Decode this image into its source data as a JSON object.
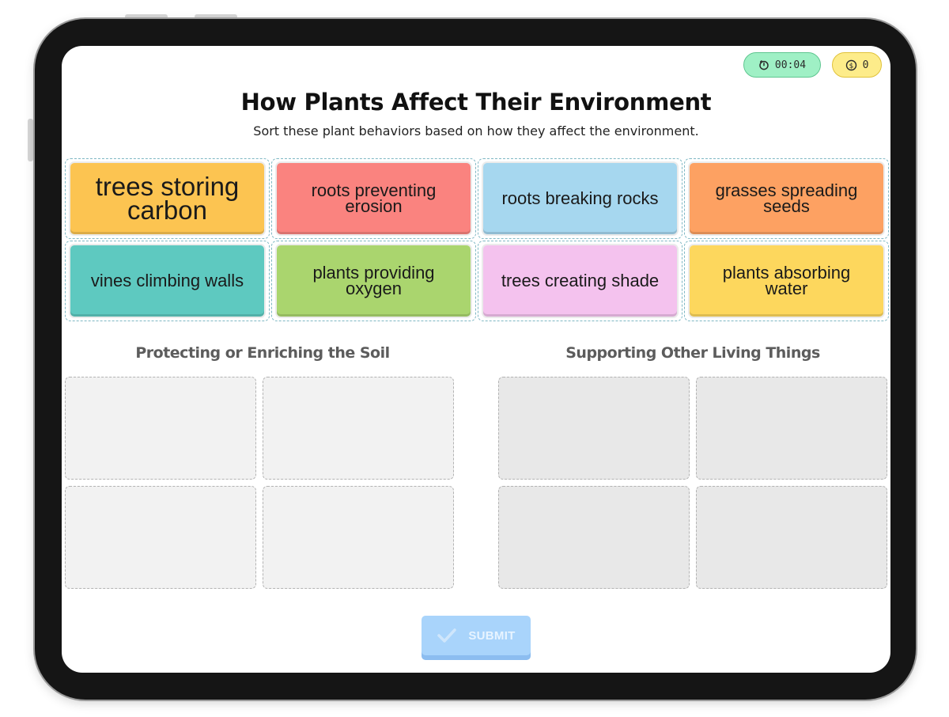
{
  "header": {
    "timer": "00:04",
    "timer_icon": "stopwatch-icon",
    "coins": "0",
    "coins_icon": "dollar-coin-icon"
  },
  "title": "How Plants Affect Their Environment",
  "subtitle": "Sort these plant behaviors based on how they affect the environment.",
  "cards": [
    {
      "label": "trees storing carbon",
      "color": "#fcc451"
    },
    {
      "label": "roots preventing erosion",
      "color": "#fa837f"
    },
    {
      "label": "roots breaking rocks",
      "color": "#a6d7ef"
    },
    {
      "label": "grasses spreading seeds",
      "color": "#fda162"
    },
    {
      "label": "vines climbing walls",
      "color": "#5ec9c0"
    },
    {
      "label": "plants providing oxygen",
      "color": "#aad56e"
    },
    {
      "label": "trees creating shade",
      "color": "#f4c2ee"
    },
    {
      "label": "plants absorbing water",
      "color": "#fdd75d"
    }
  ],
  "categories": [
    {
      "title": "Protecting or Enriching the Soil"
    },
    {
      "title": "Supporting Other Living Things"
    }
  ],
  "submit": {
    "label": "SUBMIT",
    "icon": "checkmark-icon",
    "color": "#a9d4fb"
  }
}
